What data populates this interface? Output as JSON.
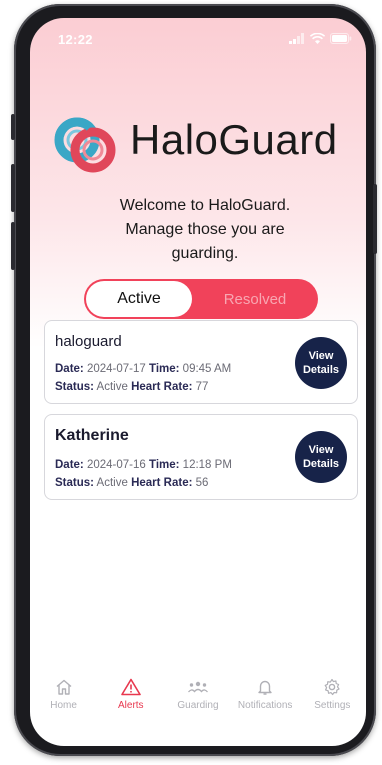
{
  "status_bar": {
    "time": "12:22"
  },
  "brand": {
    "name": "HaloGuard",
    "logo_icon": "haloguard-logo-icon",
    "colors": {
      "teal": "#3aa7c6",
      "coral": "#e0475a",
      "navy": "#172349",
      "accent": "#f1425a"
    }
  },
  "welcome_text": "Welcome to HaloGuard. Manage those you are guarding.",
  "toggle": {
    "active_label": "Active",
    "resolved_label": "Resolved",
    "selected": "Active"
  },
  "alerts": [
    {
      "name": "haloguard",
      "date_label": "Date:",
      "date": "2024-07-17",
      "time_label": "Time:",
      "time": "09:45 AM",
      "status_label": "Status:",
      "status": "Active",
      "heart_rate_label": "Heart Rate:",
      "heart_rate": "77",
      "button_line1": "View",
      "button_line2": "Details"
    },
    {
      "name": "Katherine",
      "date_label": "Date:",
      "date": "2024-07-16",
      "time_label": "Time:",
      "time": "12:18 PM",
      "status_label": "Status:",
      "status": "Active",
      "heart_rate_label": "Heart Rate:",
      "heart_rate": "56",
      "button_line1": "View",
      "button_line2": "Details"
    }
  ],
  "tabbar": {
    "items": [
      {
        "label": "Home",
        "icon": "home-icon",
        "active": false
      },
      {
        "label": "Alerts",
        "icon": "warning-icon",
        "active": true
      },
      {
        "label": "Guarding",
        "icon": "group-icon",
        "active": false
      },
      {
        "label": "Notifications",
        "icon": "bell-icon",
        "active": false
      },
      {
        "label": "Settings",
        "icon": "gear-icon",
        "active": false
      }
    ]
  }
}
